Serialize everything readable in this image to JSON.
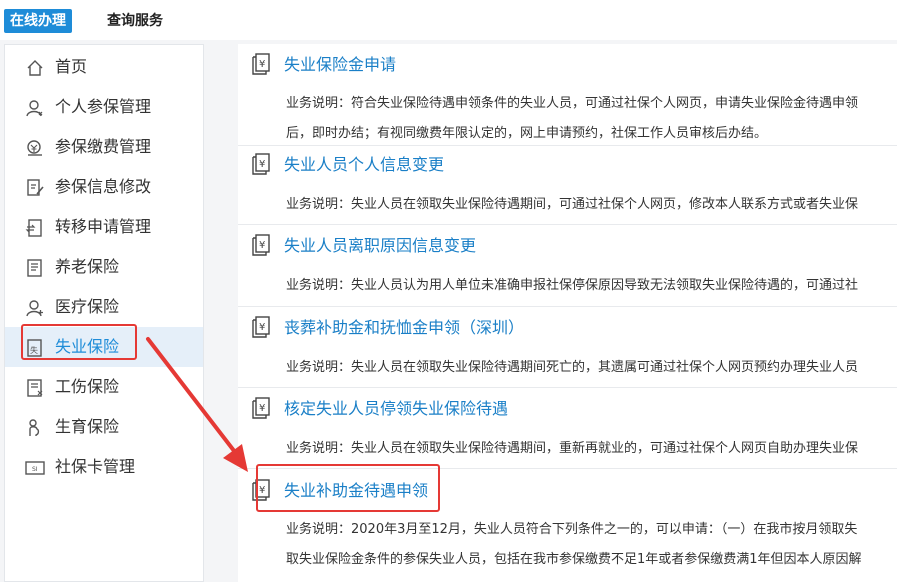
{
  "tabs": [
    "在线办理",
    "查询服务"
  ],
  "sidebar": {
    "items": [
      {
        "label": "首页",
        "icon": "home-icon"
      },
      {
        "label": "个人参保管理",
        "icon": "person-icon"
      },
      {
        "label": "参保缴费管理",
        "icon": "payment-icon"
      },
      {
        "label": "参保信息修改",
        "icon": "edit-icon"
      },
      {
        "label": "转移申请管理",
        "icon": "transfer-icon"
      },
      {
        "label": "养老保险",
        "icon": "document-icon"
      },
      {
        "label": "医疗保险",
        "icon": "medical-person-icon"
      },
      {
        "label": "失业保险",
        "icon": "unemployment-icon",
        "active": true
      },
      {
        "label": "工伤保险",
        "icon": "injury-document-icon"
      },
      {
        "label": "生育保险",
        "icon": "maternity-icon"
      },
      {
        "label": "社保卡管理",
        "icon": "card-icon"
      }
    ]
  },
  "services": [
    {
      "title": "失业保险金申请",
      "desc": [
        "业务说明：符合失业保险待遇申领条件的失业人员，可通过社保个人网页，申请失业保险金待遇申领",
        "后，即时办结；有视同缴费年限认定的，网上申请预约，社保工作人员审核后办结。"
      ]
    },
    {
      "title": "失业人员个人信息变更",
      "desc": [
        "业务说明：失业人员在领取失业保险待遇期间，可通过社保个人网页，修改本人联系方式或者失业保"
      ]
    },
    {
      "title": "失业人员离职原因信息变更",
      "desc": [
        "业务说明：失业人员认为用人单位未准确申报社保停保原因导致无法领取失业保险待遇的，可通过社"
      ]
    },
    {
      "title": "丧葬补助金和抚恤金申领（深圳）",
      "desc": [
        "业务说明：失业人员在领取失业保险待遇期间死亡的，其遗属可通过社保个人网页预约办理失业人员"
      ]
    },
    {
      "title": "核定失业人员停领失业保险待遇",
      "desc": [
        "业务说明：失业人员在领取失业保险待遇期间，重新再就业的，可通过社保个人网页自助办理失业保"
      ]
    },
    {
      "title": "失业补助金待遇申领",
      "desc": [
        "业务说明：2020年3月至12月，失业人员符合下列条件之一的，可以申请：（一）在我市按月领取失",
        "取失业保险金条件的参保失业人员，包括在我市参保缴费不足1年或者参保缴费满1年但因本人原因解"
      ]
    }
  ],
  "icon_glyph": "¥",
  "colors": {
    "accent": "#1e8cd8",
    "link": "#1a7fc7",
    "highlight": "#e53935",
    "active_bg": "#e5eff9"
  }
}
